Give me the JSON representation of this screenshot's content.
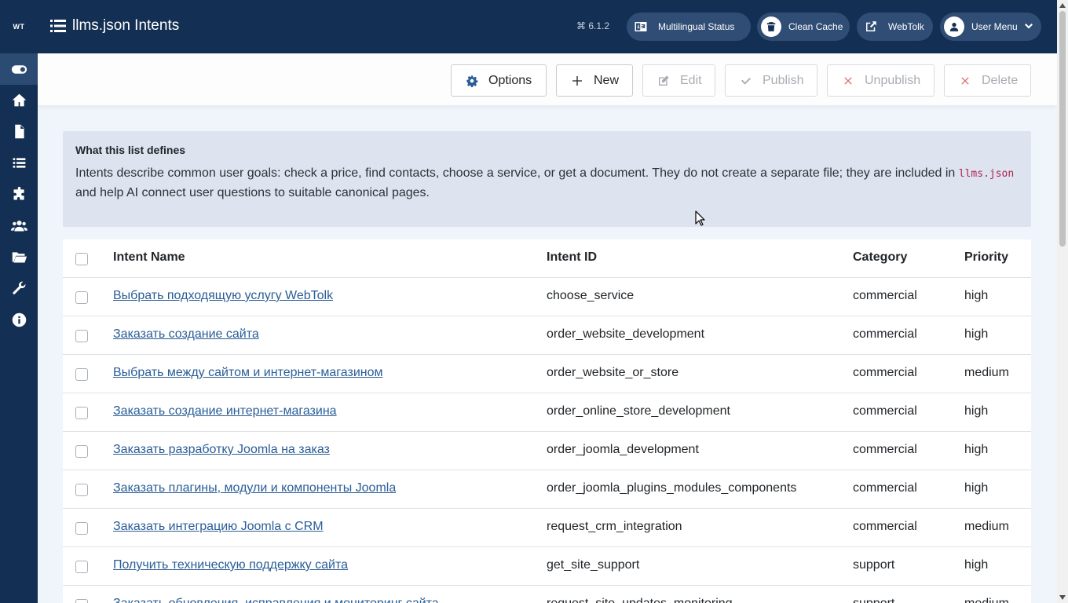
{
  "sidebar": {
    "logo": "WT",
    "items": [
      {
        "icon": "toggle-icon",
        "active": true
      },
      {
        "icon": "home-icon"
      },
      {
        "icon": "file-icon"
      },
      {
        "icon": "list-icon"
      },
      {
        "icon": "puzzle-icon"
      },
      {
        "icon": "users-icon"
      },
      {
        "icon": "folder-icon"
      },
      {
        "icon": "wrench-icon"
      },
      {
        "icon": "info-icon"
      }
    ]
  },
  "header": {
    "title": "llms.json Intents",
    "version": "⌘ 6.1.2",
    "buttons": {
      "multilingual": "Multilingual Status",
      "clean_cache": "Clean Cache",
      "webtolk": "WebTolk",
      "user_menu": "User Menu"
    }
  },
  "toolbar": {
    "options": "Options",
    "new": "New",
    "edit": "Edit",
    "publish": "Publish",
    "unpublish": "Unpublish",
    "delete": "Delete"
  },
  "info": {
    "heading": "What this list defines",
    "text_before": "Intents describe common user goals: check a price, find contacts, choose a service, or get a document. They do not create a separate file; they are included in ",
    "code": "llms.json",
    "text_after": " and help AI connect user questions to suitable canonical pages."
  },
  "table": {
    "headers": {
      "name": "Intent Name",
      "id": "Intent ID",
      "category": "Category",
      "priority": "Priority"
    },
    "rows": [
      {
        "name": "Выбрать подходящую услугу WebTolk",
        "id": "choose_service",
        "category": "commercial",
        "priority": "high"
      },
      {
        "name": "Заказать создание сайта",
        "id": "order_website_development",
        "category": "commercial",
        "priority": "high"
      },
      {
        "name": "Выбрать между сайтом и интернет-магазином",
        "id": "order_website_or_store",
        "category": "commercial",
        "priority": "medium"
      },
      {
        "name": "Заказать создание интернет-магазина",
        "id": "order_online_store_development",
        "category": "commercial",
        "priority": "high"
      },
      {
        "name": "Заказать разработку Joomla на заказ",
        "id": "order_joomla_development",
        "category": "commercial",
        "priority": "high"
      },
      {
        "name": "Заказать плагины, модули и компоненты Joomla",
        "id": "order_joomla_plugins_modules_components",
        "category": "commercial",
        "priority": "high"
      },
      {
        "name": "Заказать интеграцию Joomla с CRM",
        "id": "request_crm_integration",
        "category": "commercial",
        "priority": "medium"
      },
      {
        "name": "Получить техническую поддержку сайта",
        "id": "get_site_support",
        "category": "support",
        "priority": "high"
      },
      {
        "name": "Заказать обновления, исправления и мониторинг сайта",
        "id": "request_site_updates_monitoring",
        "category": "support",
        "priority": "medium"
      }
    ]
  }
}
